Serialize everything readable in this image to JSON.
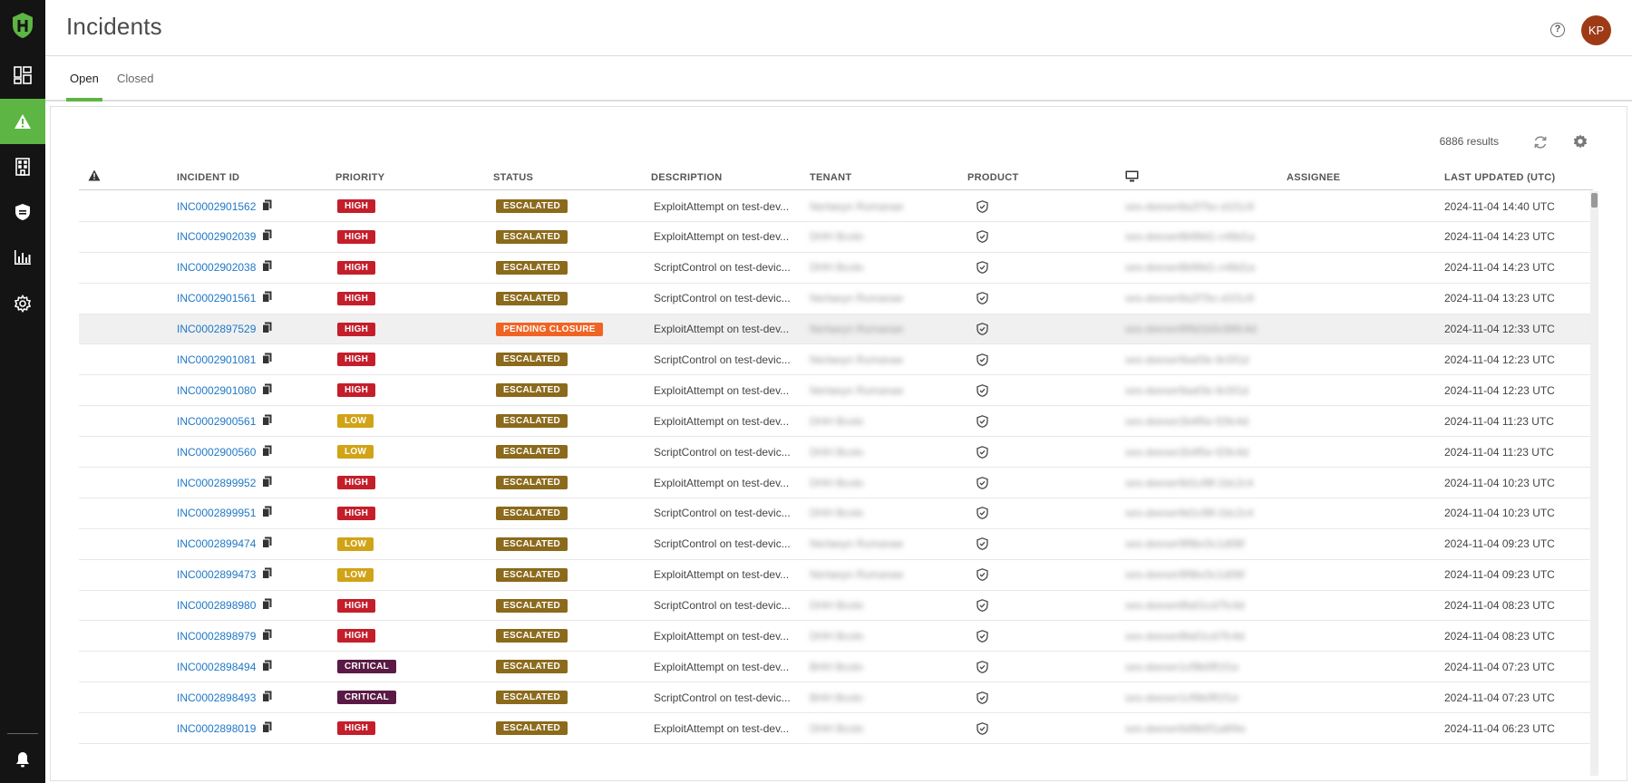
{
  "header": {
    "title": "Incidents",
    "help_label": "?",
    "avatar_initials": "KP"
  },
  "tabs": [
    {
      "label": "Open",
      "active": true
    },
    {
      "label": "Closed",
      "active": false
    }
  ],
  "toolbar": {
    "results": "6886 results"
  },
  "columns": {
    "severity": "",
    "incident_id": "INCIDENT ID",
    "priority": "PRIORITY",
    "status": "STATUS",
    "description": "DESCRIPTION",
    "tenant": "TENANT",
    "product": "PRODUCT",
    "device": "",
    "assignee": "ASSIGNEE",
    "last_updated": "LAST UPDATED (UTC)"
  },
  "colors": {
    "accent": "#5db544",
    "high": "#c41e2b",
    "low": "#d1a317",
    "critical": "#5a1a45",
    "escalated": "#8b6a1c",
    "pending": "#f06423",
    "link": "#1f78c7"
  },
  "rows": [
    {
      "id": "INC0002901562",
      "priority": "HIGH",
      "status": "ESCALATED",
      "description": "ExploitAttempt on test-dev...",
      "tenant": "Nerlaeyn Rumanae",
      "device": "ses-deeser8a2f7bc-d1f1c9",
      "updated": "2024-11-04 14:40 UTC"
    },
    {
      "id": "INC0002902039",
      "priority": "HIGH",
      "status": "ESCALATED",
      "description": "ExploitAttempt on test-dev...",
      "tenant": "DHH Bcolo",
      "device": "ses-deeser8b99d1-c48d1a",
      "updated": "2024-11-04 14:23 UTC"
    },
    {
      "id": "INC0002902038",
      "priority": "HIGH",
      "status": "ESCALATED",
      "description": "ScriptControl on test-devic...",
      "tenant": "DHH Bcolo",
      "device": "ses-deeser8b99d1-c48d1a",
      "updated": "2024-11-04 14:23 UTC"
    },
    {
      "id": "INC0002901561",
      "priority": "HIGH",
      "status": "ESCALATED",
      "description": "ScriptControl on test-devic...",
      "tenant": "Nerlaeyn Rumanae",
      "device": "ses-deeser8a2f7bc-d1f1c9",
      "updated": "2024-11-04 13:23 UTC"
    },
    {
      "id": "INC0002897529",
      "priority": "HIGH",
      "status": "PENDING CLOSURE",
      "description": "ExploitAttempt on test-dev...",
      "tenant": "Nerlaeyn Rumanae",
      "device": "ses-deeser8f9d1b5c88fc4d",
      "updated": "2024-11-04 12:33 UTC"
    },
    {
      "id": "INC0002901081",
      "priority": "HIGH",
      "status": "ESCALATED",
      "description": "ScriptControl on test-devic...",
      "tenant": "Nerlaeyn Rumanae",
      "device": "ses-deeser9aaf3e-9c5f1d",
      "updated": "2024-11-04 12:23 UTC"
    },
    {
      "id": "INC0002901080",
      "priority": "HIGH",
      "status": "ESCALATED",
      "description": "ExploitAttempt on test-dev...",
      "tenant": "Nerlaeyn Rumanae",
      "device": "ses-deeser9aaf3e-9c5f1d",
      "updated": "2024-11-04 12:23 UTC"
    },
    {
      "id": "INC0002900561",
      "priority": "LOW",
      "status": "ESCALATED",
      "description": "ExploitAttempt on test-dev...",
      "tenant": "DHH Bcolo",
      "device": "ses-deeser2b4f5e-f29c4d",
      "updated": "2024-11-04 11:23 UTC"
    },
    {
      "id": "INC0002900560",
      "priority": "LOW",
      "status": "ESCALATED",
      "description": "ScriptControl on test-devic...",
      "tenant": "DHH Bcolo",
      "device": "ses-deeser2b4f5e-f29c4d",
      "updated": "2024-11-04 11:23 UTC"
    },
    {
      "id": "INC0002899952",
      "priority": "HIGH",
      "status": "ESCALATED",
      "description": "ExploitAttempt on test-dev...",
      "tenant": "DHH Bcolo",
      "device": "ses-deeser9d1cf8f-2dc2c4",
      "updated": "2024-11-04 10:23 UTC"
    },
    {
      "id": "INC0002899951",
      "priority": "HIGH",
      "status": "ESCALATED",
      "description": "ScriptControl on test-devic...",
      "tenant": "DHH Bcolo",
      "device": "ses-deeser9d1cf8f-2dc2c4",
      "updated": "2024-11-04 10:23 UTC"
    },
    {
      "id": "INC0002899474",
      "priority": "LOW",
      "status": "ESCALATED",
      "description": "ScriptControl on test-devic...",
      "tenant": "Nerlaeyn Rumanae",
      "device": "ses-deeser9f9bc5c1d08f",
      "updated": "2024-11-04 09:23 UTC"
    },
    {
      "id": "INC0002899473",
      "priority": "LOW",
      "status": "ESCALATED",
      "description": "ExploitAttempt on test-dev...",
      "tenant": "Nerlaeyn Rumanae",
      "device": "ses-deeser9f9bc5c1d08f",
      "updated": "2024-11-04 09:23 UTC"
    },
    {
      "id": "INC0002898980",
      "priority": "HIGH",
      "status": "ESCALATED",
      "description": "ScriptControl on test-devic...",
      "tenant": "DHH Bcolo",
      "device": "ses-deeser8fa01cd7fc4d",
      "updated": "2024-11-04 08:23 UTC"
    },
    {
      "id": "INC0002898979",
      "priority": "HIGH",
      "status": "ESCALATED",
      "description": "ExploitAttempt on test-dev...",
      "tenant": "DHH Bcolo",
      "device": "ses-deeser8fa01cd7fc4d",
      "updated": "2024-11-04 08:23 UTC"
    },
    {
      "id": "INC0002898494",
      "priority": "CRITICAL",
      "status": "ESCALATED",
      "description": "ExploitAttempt on test-dev...",
      "tenant": "BHH Bcolo",
      "device": "ses-deeser1cf9b0ff1f1e",
      "updated": "2024-11-04 07:23 UTC"
    },
    {
      "id": "INC0002898493",
      "priority": "CRITICAL",
      "status": "ESCALATED",
      "description": "ScriptControl on test-devic...",
      "tenant": "BHH Bcolo",
      "device": "ses-deeser1cf9b0ff1f1e",
      "updated": "2024-11-04 07:23 UTC"
    },
    {
      "id": "INC0002898019",
      "priority": "HIGH",
      "status": "ESCALATED",
      "description": "ExploitAttempt on test-dev...",
      "tenant": "DHH Bcolo",
      "device": "ses-deeser6d9b0f1a8f4e",
      "updated": "2024-11-04 06:23 UTC"
    }
  ]
}
